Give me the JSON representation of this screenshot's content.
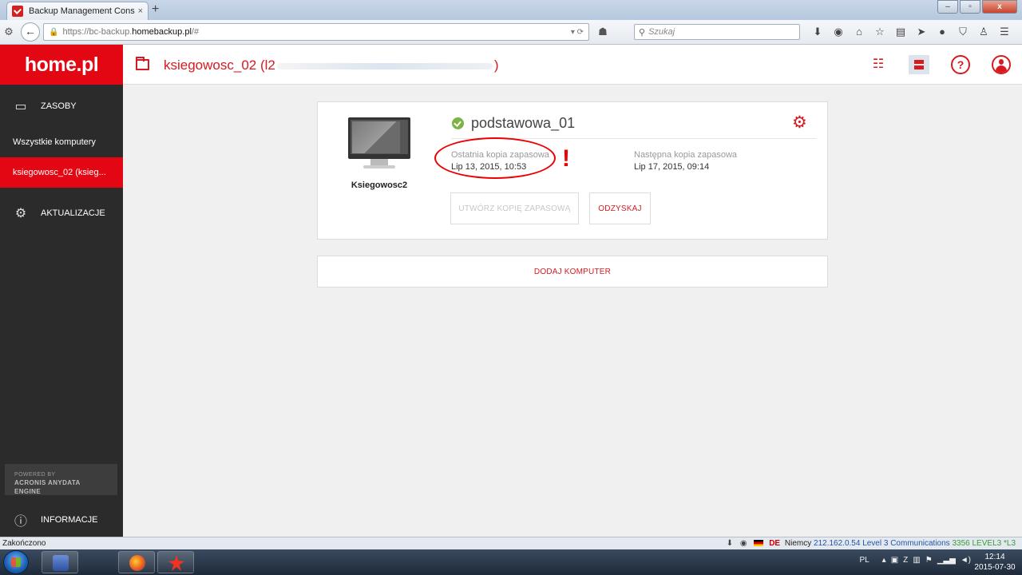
{
  "browser": {
    "tab_title": "Backup Management Cons...",
    "tab_close": "×",
    "new_tab": "+",
    "url_prefix": "https://bc-backup.",
    "url_host": "homebackup.pl",
    "url_suffix": "/#",
    "search_placeholder": "Szukaj",
    "window_controls": [
      "–",
      "▫",
      "x"
    ]
  },
  "sidebar": {
    "logo": "home.pl",
    "resources_label": "ZASOBY",
    "all_computers": "Wszystkie komputery",
    "active_computer": "ksiegowosc_02 (ksieg...",
    "updates_label": "AKTUALIZACJE",
    "powered_by": "POWERED BY",
    "engine": "ACRONIS ANYDATA ENGINE",
    "info_label": "INFORMACJE"
  },
  "topbar": {
    "breadcrumb_start": "ksiegowosc_02 (l2",
    "breadcrumb_end": ")"
  },
  "card": {
    "computer_name": "Ksiegowosc2",
    "plan_name": "podstawowa_01",
    "last_backup_label": "Ostatnia kopia zapasowa",
    "last_backup_value": "Lip 13, 2015, 10:53",
    "next_backup_label": "Następna kopia zapasowa",
    "next_backup_value": "Lip 17, 2015, 09:14",
    "alert_mark": "!",
    "create_backup_button": "UTWÓRZ KOPIĘ ZAPASOWĄ",
    "recover_button": "ODZYSKAJ"
  },
  "add_computer": "DODAJ KOMPUTER",
  "statusbar": {
    "left": "Zakończono",
    "country_code": "DE",
    "country": "Niemcy",
    "ip": "212.162.0.54",
    "isp": "Level 3 Communications",
    "asn": "3356",
    "as_name": "LEVEL3",
    "extra": "*L3"
  },
  "taskbar": {
    "language": "PL",
    "time": "12:14",
    "date": "2015-07-30"
  },
  "colors": {
    "brand_red": "#e30613",
    "accent_red": "#d71920",
    "sidebar_bg": "#2b2b2b",
    "ok_green": "#7cb342"
  }
}
